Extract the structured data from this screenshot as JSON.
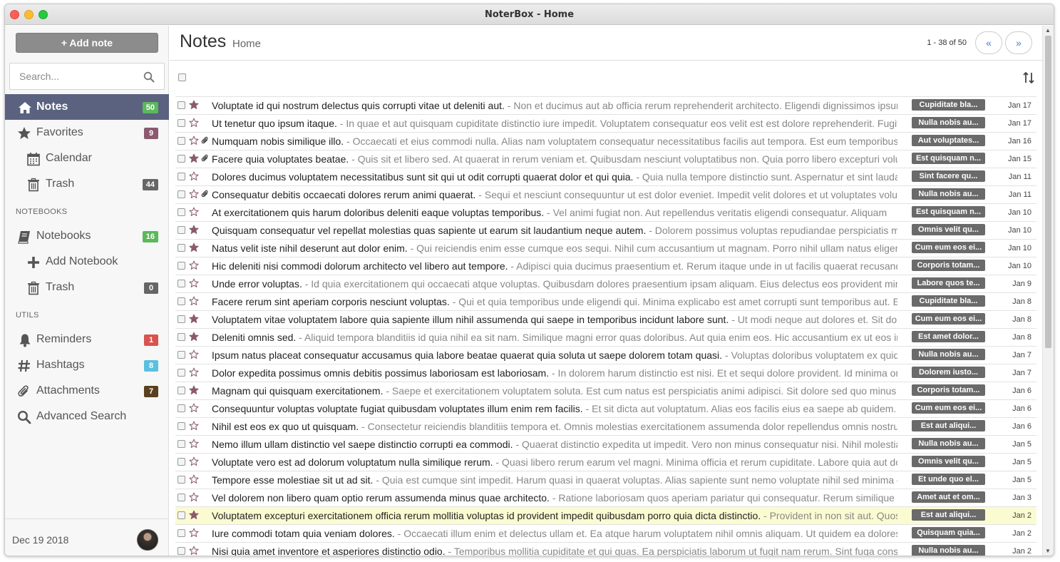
{
  "window": {
    "title": "NoterBox - Home"
  },
  "sidebar": {
    "add_note_label": "+ Add note",
    "search_placeholder": "Search...",
    "nav": [
      {
        "label": "Notes",
        "badge": "50",
        "badge_color": "#5cb85c",
        "icon": "home-icon",
        "active": true
      },
      {
        "label": "Favorites",
        "badge": "9",
        "badge_color": "#8b5a6e",
        "icon": "star-icon"
      },
      {
        "label": "Calendar",
        "icon": "calendar-icon"
      },
      {
        "label": "Trash",
        "badge": "44",
        "badge_color": "#666666",
        "icon": "trash-icon"
      }
    ],
    "notebooks_label": "NOTEBOOKS",
    "notebooks_nav": [
      {
        "label": "Notebooks",
        "badge": "16",
        "badge_color": "#5cb85c",
        "icon": "book-icon"
      },
      {
        "label": "Add Notebook",
        "icon": "plus-icon"
      },
      {
        "label": "Trash",
        "badge": "0",
        "badge_color": "#666666",
        "icon": "trash-icon"
      }
    ],
    "utils_label": "UTILS",
    "utils_nav": [
      {
        "label": "Reminders",
        "badge": "1",
        "badge_color": "#d9534f",
        "icon": "bell-icon"
      },
      {
        "label": "Hashtags",
        "badge": "8",
        "badge_color": "#5bc0de",
        "icon": "hashtag-icon"
      },
      {
        "label": "Attachments",
        "badge": "7",
        "badge_color": "#5a4020",
        "icon": "paperclip-icon"
      },
      {
        "label": "Advanced Search",
        "icon": "search-icon"
      }
    ],
    "footer_date": "Dec 19 2018"
  },
  "main": {
    "title": "Notes",
    "breadcrumb": "Home",
    "pager_text": "1 - 38 of 50",
    "pager_prev": "«",
    "pager_next": "»"
  },
  "colors": {
    "accent": "#5a6280",
    "star_purple": "#8b5a6e",
    "tag_gray": "#6a6a6a",
    "highlight": "#fbfbd2"
  },
  "notes": [
    {
      "title": "Voluptate id qui nostrum delectus quis corrupti vitae ut deleniti aut.",
      "excerpt": " - Non et ducimus aut ab officia rerum reprehenderit architecto. Eligendi dignissimos ipsum",
      "tag": "Cupiditate bla...",
      "date": "Jan 17",
      "starred": true,
      "attachment": false
    },
    {
      "title": "Ut tenetur quo ipsum itaque.",
      "excerpt": " - In quae et aut quisquam cupiditate distinctio iure impedit. Voluptatem consequatur eos velit est est dolore reprehenderit. Fugit",
      "tag": "Nulla nobis au...",
      "date": "Jan 17",
      "starred": false,
      "attachment": false
    },
    {
      "title": "Numquam nobis similique illo.",
      "excerpt": " - Occaecati et eius commodi nulla. Alias nam voluptatem consequatur necessitatibus facilis aut tempora. Est eum temporibus",
      "tag": "Aut voluptates...",
      "date": "Jan 16",
      "starred": false,
      "attachment": true
    },
    {
      "title": "Facere quia voluptates beatae.",
      "excerpt": " - Quis sit et libero sed. At quaerat in rerum veniam et. Quibusdam nesciunt voluptatibus non. Quia porro libero excepturi voluptas",
      "tag": "Est quisquam n...",
      "date": "Jan 15",
      "starred": true,
      "attachment": true
    },
    {
      "title": "Dolores ducimus voluptatem necessitatibus sunt sit qui ut odit corrupti quaerat dolor et qui quia.",
      "excerpt": " - Quia nulla tempore distinctio sunt. Aspernatur et sint laudantium",
      "tag": "Sint facere qu...",
      "date": "Jan 11",
      "starred": false,
      "attachment": false
    },
    {
      "title": "Consequatur debitis occaecati dolores rerum animi quaerat.",
      "excerpt": " - Sequi et nesciunt consequuntur ut est dolor eveniet. Impedit velit dolores et ut voluptates voluptas",
      "tag": "Nulla nobis au...",
      "date": "Jan 11",
      "starred": false,
      "attachment": true
    },
    {
      "title": "At exercitationem quis harum doloribus deleniti eaque voluptas temporibus.",
      "excerpt": " - Vel animi fugiat non. Aut repellendus veritatis eligendi consequatur. Aliquam",
      "tag": "Est quisquam n...",
      "date": "Jan 10",
      "starred": false,
      "attachment": false
    },
    {
      "title": "Quisquam consequatur vel repellat molestias quas sapiente ut earum sit laudantium neque autem.",
      "excerpt": " - Dolorem possimus voluptas repudiandae perspiciatis maxime",
      "tag": "Omnis velit qu...",
      "date": "Jan 10",
      "starred": true,
      "attachment": false
    },
    {
      "title": "Natus velit iste nihil deserunt aut dolor enim.",
      "excerpt": " - Qui reiciendis enim esse cumque eos sequi. Nihil cum accusantium ut magnam. Porro nihil ullam natus eligendi",
      "tag": "Cum eum eos ei...",
      "date": "Jan 10",
      "starred": true,
      "attachment": false
    },
    {
      "title": "Hic deleniti nisi commodi dolorum architecto vel libero aut tempore.",
      "excerpt": " - Adipisci quia ducimus praesentium et. Rerum itaque unde in ut facilis quaerat recusandae",
      "tag": "Corporis totam...",
      "date": "Jan 10",
      "starred": false,
      "attachment": false
    },
    {
      "title": "Unde error voluptas.",
      "excerpt": " - Id quia exercitationem qui occaecati atque voluptas. Quibusdam dolores praesentium ipsam aliquam. Eius delectus eos provident minima",
      "tag": "Labore quos te...",
      "date": "Jan 9",
      "starred": false,
      "attachment": false
    },
    {
      "title": "Facere rerum sint aperiam corporis nesciunt voluptas.",
      "excerpt": " - Qui et quia temporibus unde eligendi qui. Minima explicabo est amet corrupti sunt temporibus aut. Et",
      "tag": "Cupiditate bla...",
      "date": "Jan 8",
      "starred": false,
      "attachment": false
    },
    {
      "title": "Voluptatem vitae voluptatem labore quia sapiente illum nihil assumenda qui saepe in temporibus incidunt labore sunt.",
      "excerpt": " - Ut modi neque aut dolores et. Sit dolorem",
      "tag": "Cum eum eos ei...",
      "date": "Jan 8",
      "starred": true,
      "attachment": false
    },
    {
      "title": "Deleniti omnis sed.",
      "excerpt": " - Aliquid tempora blanditiis id quia nihil ea sit nam. Similique magni error quas doloribus. Aut quia enim eos. Hic accusantium ex ut eos in",
      "tag": "Est amet dolor...",
      "date": "Jan 8",
      "starred": true,
      "attachment": false
    },
    {
      "title": "Ipsum natus placeat consequatur accusamus quia labore beatae quaerat quia soluta ut saepe dolorem totam quasi.",
      "excerpt": " - Voluptas doloribus voluptatem ex quidem",
      "tag": "Nulla nobis au...",
      "date": "Jan 7",
      "starred": false,
      "attachment": false
    },
    {
      "title": "Dolor expedita possimus omnis debitis possimus laboriosam est laboriosam.",
      "excerpt": " - In dolorem harum distinctio est nisi. Et et sequi dolore provident. Id minima omnis",
      "tag": "Dolorem iusto...",
      "date": "Jan 7",
      "starred": false,
      "attachment": false
    },
    {
      "title": "Magnam qui quisquam exercitationem.",
      "excerpt": " - Saepe et exercitationem voluptatem soluta. Est cum natus est perspiciatis animi adipisci. Sit dolore sed quo minus",
      "tag": "Corporis totam...",
      "date": "Jan 6",
      "starred": true,
      "attachment": false
    },
    {
      "title": "Consequuntur voluptas voluptate fugiat quibusdam voluptates illum enim rem facilis.",
      "excerpt": " - Et sit dicta aut voluptatum. Alias eos facilis eius ea saepe ab quidem. Et",
      "tag": "Cum eum eos ei...",
      "date": "Jan 6",
      "starred": false,
      "attachment": false
    },
    {
      "title": "Nihil est eos ex quo ut quisquam.",
      "excerpt": " - Consectetur reiciendis blanditiis tempora et. Omnis molestias exercitationem assumenda dolor repellendus omnis nostrum",
      "tag": "Est aut aliqui...",
      "date": "Jan 6",
      "starred": false,
      "attachment": false
    },
    {
      "title": "Nemo illum ullam distinctio vel saepe distinctio corrupti ea commodi.",
      "excerpt": " - Quaerat distinctio expedita ut impedit. Vero non minus consequatur nisi. Nihil molestias",
      "tag": "Nulla nobis au...",
      "date": "Jan 5",
      "starred": false,
      "attachment": false
    },
    {
      "title": "Voluptate vero est ad dolorum voluptatum nulla similique rerum.",
      "excerpt": " - Quasi libero rerum earum vel magni. Minima officia et rerum cupiditate. Labore quia aut dolores",
      "tag": "Omnis velit qu...",
      "date": "Jan 5",
      "starred": false,
      "attachment": false
    },
    {
      "title": "Tempore esse molestiae sit ut ad sit.",
      "excerpt": " - Quia est cumque sint impedit. Harum quasi in quaerat voluptas. Alias sapiente sunt nemo voluptate nihil sed minima et",
      "tag": "Et unde quo el...",
      "date": "Jan 5",
      "starred": false,
      "attachment": false
    },
    {
      "title": "Vel dolorem non libero quam optio rerum assumenda minus quae architecto.",
      "excerpt": " - Ratione laboriosam quos aperiam pariatur qui consequatur. Rerum similique et",
      "tag": "Amet aut et om...",
      "date": "Jan 3",
      "starred": false,
      "attachment": false
    },
    {
      "title": "Voluptatem excepturi exercitationem officia rerum mollitia voluptas id provident impedit quibusdam porro quia dicta distinctio.",
      "excerpt": " - Provident in non sit aut. Quos",
      "tag": "Est aut aliqui...",
      "date": "Jan 2",
      "starred": true,
      "attachment": false,
      "highlighted": true
    },
    {
      "title": "Iure commodi totam quia veniam dolores.",
      "excerpt": " - Occaecati illum enim et delectus ullam et. Ea atque harum voluptatem nihil omnis aliquam. Ut quidem ea dolores",
      "tag": "Quisquam quia...",
      "date": "Jan 2",
      "starred": false,
      "attachment": false
    },
    {
      "title": "Nisi quia amet inventore et asperiores distinctio odio.",
      "excerpt": " - Temporibus mollitia cupiditate et qui quas. Ea perspiciatis laborum ut fugit nam rerum. Sint fuga consequatur",
      "tag": "Nulla nobis au...",
      "date": "Jan 2",
      "starred": false,
      "attachment": false
    }
  ]
}
